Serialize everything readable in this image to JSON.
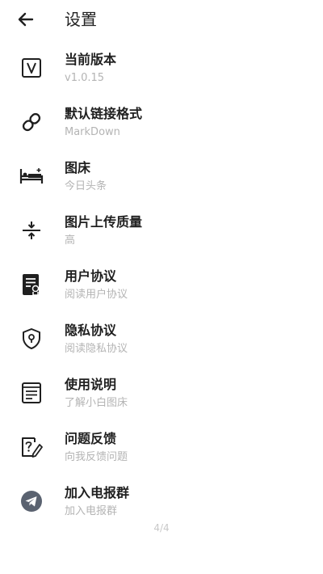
{
  "header": {
    "title": "设置",
    "back_icon": "arrow-left-icon"
  },
  "items": [
    {
      "icon": "version-icon",
      "title": "当前版本",
      "subtitle": "v1.0.15"
    },
    {
      "icon": "link-icon",
      "title": "默认链接格式",
      "subtitle": "MarkDown"
    },
    {
      "icon": "bed-icon",
      "title": "图床",
      "subtitle": "今日头条"
    },
    {
      "icon": "compress-icon",
      "title": "图片上传质量",
      "subtitle": "高"
    },
    {
      "icon": "agreement-icon",
      "title": "用户协议",
      "subtitle": "阅读用户协议"
    },
    {
      "icon": "privacy-shield-icon",
      "title": "隐私协议",
      "subtitle": "阅读隐私协议"
    },
    {
      "icon": "instructions-icon",
      "title": "使用说明",
      "subtitle": "了解小白图床"
    },
    {
      "icon": "feedback-icon",
      "title": "问题反馈",
      "subtitle": "向我反馈问题"
    },
    {
      "icon": "telegram-icon",
      "title": "加入电报群",
      "subtitle": "加入电报群"
    }
  ],
  "pager": "4/4",
  "colors": {
    "title_text": "#1f1f1f",
    "subtitle_text": "#b4b4b4",
    "icon_dark": "#1f1f1f",
    "telegram_bg": "#5a6270"
  }
}
